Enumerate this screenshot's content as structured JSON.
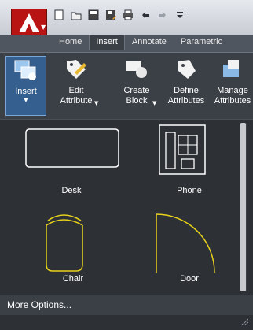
{
  "quick_access": {
    "icons": [
      "new-icon",
      "open-icon",
      "save-icon",
      "saveas-icon",
      "print-icon",
      "undo-icon",
      "redo-icon",
      "customize-icon"
    ]
  },
  "ribbon": {
    "tabs": [
      {
        "label": "Home"
      },
      {
        "label": "Insert"
      },
      {
        "label": "Annotate"
      },
      {
        "label": "Parametric"
      }
    ],
    "active_tab": "Insert",
    "tools": [
      {
        "label": "Insert",
        "active": true
      },
      {
        "label": "Edit\nAttribute"
      },
      {
        "label": "Create\nBlock"
      },
      {
        "label": "Define\nAttributes"
      },
      {
        "label": "Manage\nAttributes"
      }
    ]
  },
  "gallery": {
    "items": [
      {
        "name": "Desk"
      },
      {
        "name": "Phone"
      },
      {
        "name": "Chair"
      },
      {
        "name": "Door"
      }
    ],
    "more_options": "More Options..."
  },
  "colors": {
    "app_red": "#b81414",
    "ribbon_bg": "#3b4047",
    "gallery_bg": "#2d3136",
    "block_white": "#ffffff",
    "block_yellow": "#e8d21a",
    "active_tool": "#355f8f"
  }
}
